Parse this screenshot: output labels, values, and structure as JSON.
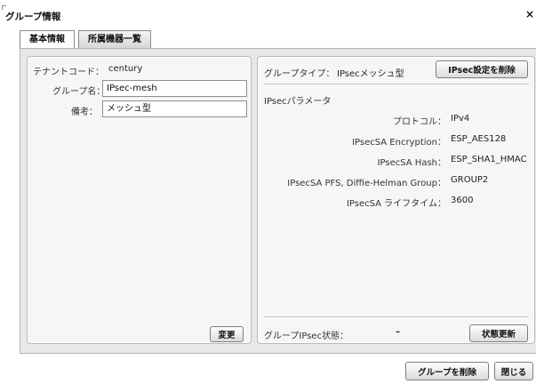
{
  "dialog": {
    "title": "グループ情報",
    "close_glyph": "×"
  },
  "tabs": [
    {
      "label": "基本情報",
      "active": true
    },
    {
      "label": "所属機器一覧",
      "active": false
    }
  ],
  "basic": {
    "tenant_code_label": "テナントコード：",
    "tenant_code_value": "century",
    "group_name_label": "グループ名：",
    "required_mark": "＊",
    "group_name_value": "IPsec-mesh",
    "note_label": "備考：",
    "note_value": "メッシュ型",
    "change_button": "変更"
  },
  "ipsec": {
    "group_type_label": "グループタイプ：",
    "group_type_value": "IPsecメッシュ型",
    "delete_settings_button": "IPsec設定を削除",
    "params_heading": "IPsecパラメータ",
    "params": [
      {
        "label": "プロトコル：",
        "value": "IPv4"
      },
      {
        "label": "IPsecSA Encryption：",
        "value": "ESP_AES128"
      },
      {
        "label": "IPsecSA Hash：",
        "value": "ESP_SHA1_HMAC"
      },
      {
        "label": "IPsecSA PFS, Diffie-Helman Group：",
        "value": "GROUP2"
      },
      {
        "label": "IPsecSA ライフタイム：",
        "value": "3600"
      }
    ],
    "status_label": "グループIPsec状態：",
    "status_value": "–",
    "refresh_button": "状態更新"
  },
  "footer": {
    "delete_group_button": "グループを削除",
    "close_button": "閉じる"
  }
}
